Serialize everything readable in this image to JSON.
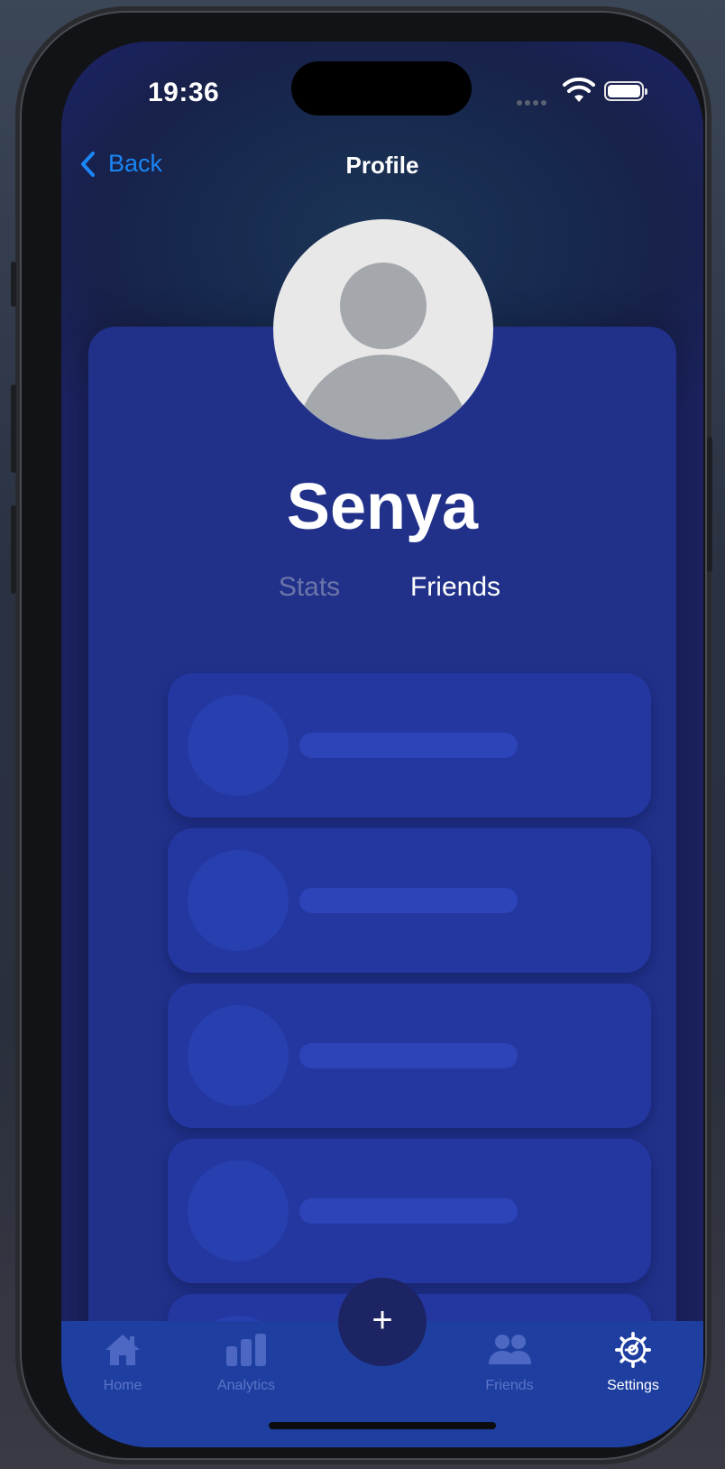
{
  "status_bar": {
    "time": "19:36"
  },
  "nav": {
    "back_label": "Back",
    "title": "Profile"
  },
  "profile": {
    "username": "Senya",
    "tabs": [
      {
        "label": "Stats",
        "active": false
      },
      {
        "label": "Friends",
        "active": true
      }
    ]
  },
  "friends": {
    "placeholder_count": 5
  },
  "tab_bar": {
    "items": [
      {
        "label": "Home",
        "icon": "house-icon",
        "active": false
      },
      {
        "label": "Analytics",
        "icon": "bar-chart-icon",
        "active": false
      },
      {
        "label": "Friends",
        "icon": "people-icon",
        "active": false
      },
      {
        "label": "Settings",
        "icon": "gear-icon",
        "active": true
      }
    ],
    "add_button": "+"
  },
  "colors": {
    "accent_link": "#1a86f5",
    "card_bg": "#21318a",
    "tab_bar_bg": "#1f3fa0",
    "fab_bg": "#1d2464"
  }
}
